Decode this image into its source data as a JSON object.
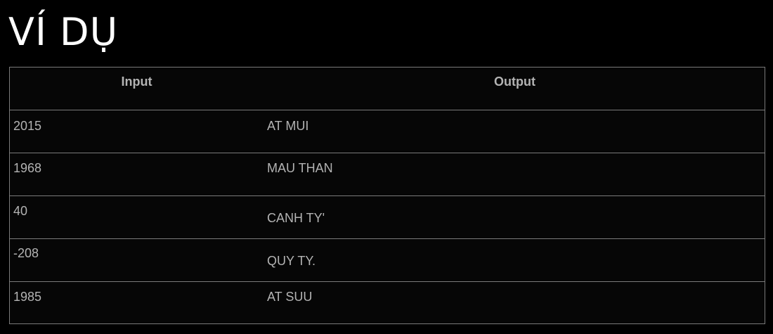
{
  "title": "VÍ DỤ",
  "table": {
    "headers": {
      "input": "Input",
      "output": "Output"
    },
    "rows": [
      {
        "input": "2015",
        "output": "AT MUI"
      },
      {
        "input": "1968",
        "output": "MAU THAN"
      },
      {
        "input": "40",
        "output": "CANH TY'"
      },
      {
        "input": "-208",
        "output": "QUY TY."
      },
      {
        "input": "1985",
        "output": "AT SUU"
      }
    ]
  },
  "colors": {
    "background": "#000000",
    "table_background": "#060606",
    "border": "#7a7a7a",
    "title_text": "#ffffff",
    "table_text": "#b3b3b3"
  }
}
